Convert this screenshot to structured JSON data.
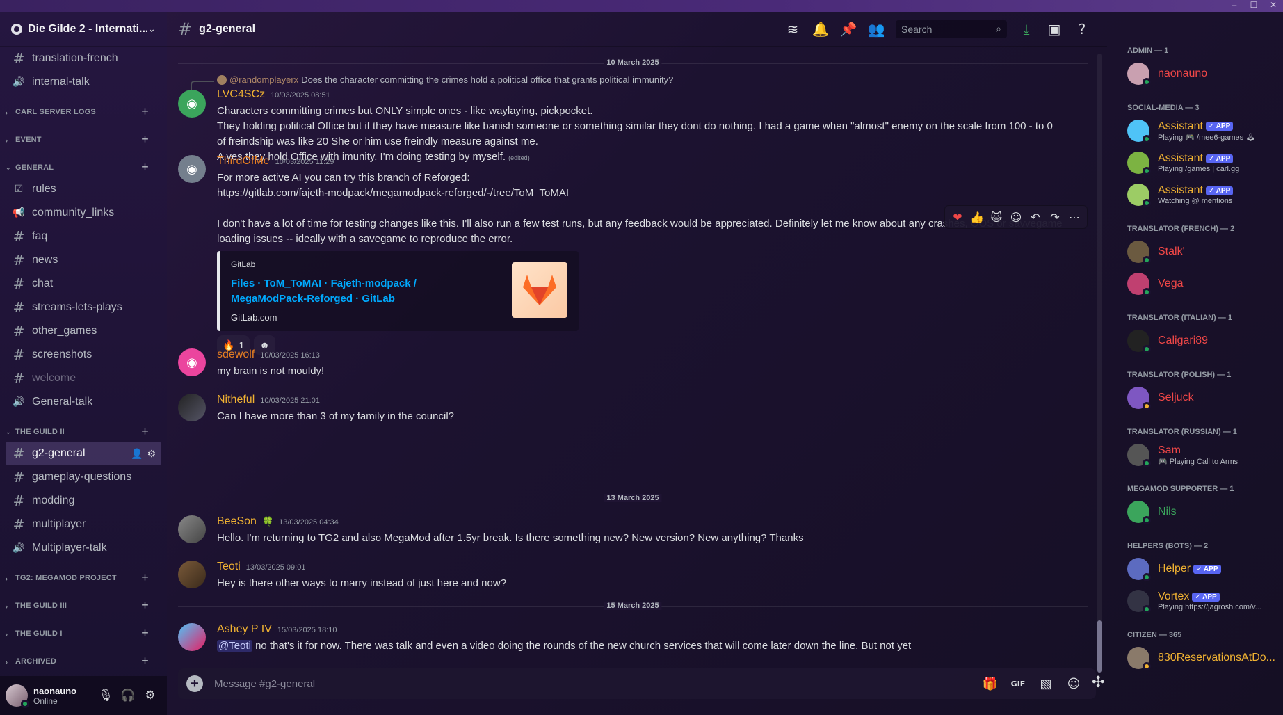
{
  "window": {
    "minimize": "–",
    "maximize": "☐",
    "close": "✕"
  },
  "server": {
    "name": "Die Gilde 2 - Internati..."
  },
  "sidebar": {
    "top_channels": [
      {
        "name": "translation-french",
        "icon": "hash-icon"
      },
      {
        "name": "internal-talk",
        "icon": "speaker-icon"
      }
    ],
    "categories": [
      {
        "label": "CARL SERVER LOGS",
        "collapsed": true,
        "channels": []
      },
      {
        "label": "EVENT",
        "collapsed": true,
        "channels": []
      },
      {
        "label": "GENERAL",
        "collapsed": false,
        "channels": [
          {
            "name": "rules",
            "icon": "checklist-icon"
          },
          {
            "name": "community_links",
            "icon": "megaphone-icon"
          },
          {
            "name": "faq",
            "icon": "hash-icon"
          },
          {
            "name": "news",
            "icon": "hash-icon"
          },
          {
            "name": "chat",
            "icon": "hash-icon"
          },
          {
            "name": "streams-lets-plays",
            "icon": "hash-icon"
          },
          {
            "name": "other_games",
            "icon": "hash-icon"
          },
          {
            "name": "screenshots",
            "icon": "hash-icon"
          },
          {
            "name": "welcome",
            "icon": "hash-icon",
            "muted": true
          },
          {
            "name": "General-talk",
            "icon": "speaker-icon"
          }
        ]
      },
      {
        "label": "THE GUILD II",
        "collapsed": false,
        "channels": [
          {
            "name": "g2-general",
            "icon": "hash-icon",
            "active": true
          },
          {
            "name": "gameplay-questions",
            "icon": "hash-icon"
          },
          {
            "name": "modding",
            "icon": "hash-icon"
          },
          {
            "name": "multiplayer",
            "icon": "hash-icon"
          },
          {
            "name": "Multiplayer-talk",
            "icon": "speaker-icon"
          }
        ]
      },
      {
        "label": "TG2: MEGAMOD PROJECT",
        "collapsed": true,
        "channels": []
      },
      {
        "label": "THE GUILD III",
        "collapsed": true,
        "channels": []
      },
      {
        "label": "THE GUILD I",
        "collapsed": true,
        "channels": []
      },
      {
        "label": "ARCHIVED",
        "collapsed": true,
        "channels": []
      }
    ]
  },
  "user": {
    "name": "naonauno",
    "status": "Online"
  },
  "channel": {
    "name": "g2-general",
    "search_placeholder": "Search",
    "composer_placeholder": "Message #g2-general"
  },
  "dividers": [
    "10 March 2025",
    "13 March 2025",
    "15 March 2025"
  ],
  "messages": [
    {
      "reply_to": "@randomplayerx",
      "reply_text": "Does the character committing the crimes hold a political office that grants political immunity?",
      "author": "LVC4SCz",
      "author_color": "#f0b232",
      "time": "10/03/2025 08:51",
      "lines": [
        "Characters committing crimes but ONLY simple ones - like  waylaying, pickpocket.",
        "They holding political Office but if they have measure like banish someone or something similar they dont do nothing. I had a game when \"almost\" enemy on the scale from 100 - to 0",
        "of freindship was like 20 She or him use freindly measure against me.",
        "A yes they hold Office with imunity. I'm doing testing by myself."
      ],
      "edited": "(edited)"
    },
    {
      "author": "ThirdOfMe",
      "author_color": "#e67e22",
      "time": "10/03/2025 11:29",
      "lines": [
        "For more active AI you can try this branch of Reforged:"
      ],
      "link": "https://gitlab.com/fajeth-modpack/megamodpack-reforged/-/tree/ToM_ToMAI",
      "lines2": [
        "I don't have a lot of time for testing changes like this. I'll also run a few test runs, but any feedback would be appreciated. Definitely let me know about any crashes, OOS or savvegame",
        "loading issues -- ideally with a savegame to reproduce the error."
      ],
      "embed": {
        "provider": "GitLab",
        "title": "Files · ToM_ToMAI · Fajeth-modpack / MegaModPack-Reforged · GitLab",
        "site": "GitLab.com"
      },
      "reactions": [
        {
          "emoji": "🔥",
          "count": "1"
        },
        {
          "emoji": "☻",
          "count": ""
        }
      ]
    },
    {
      "author": "sdewolf",
      "author_color": "#e67e22",
      "time": "10/03/2025 16:13",
      "lines": [
        "my brain is not mouldy!"
      ]
    },
    {
      "author": "Nitheful",
      "author_color": "#f0b232",
      "time": "10/03/2025 21:01",
      "lines": [
        "Can I have more than 3 of my family in the council?"
      ]
    },
    {
      "author": "BeeSon",
      "author_color": "#f0b232",
      "time": "13/03/2025 04:34",
      "badge": "🍀",
      "lines": [
        "Hello. I'm returning to TG2 and also MegaMod after 1.5yr break. Is there something new? New version? New anything? Thanks"
      ]
    },
    {
      "author": "Teoti",
      "author_color": "#f0b232",
      "time": "13/03/2025 09:01",
      "lines": [
        "Hey is there other ways to marry instead of just here and now?"
      ]
    },
    {
      "author": "Ashey P IV",
      "author_color": "#f0b232",
      "time": "15/03/2025 18:10",
      "mention": "@Teoti",
      "lines": [
        "no that's it for now. There was talk and even a video doing the rounds of the new church services that will come later down the line. But not yet"
      ]
    }
  ],
  "hover_actions": [
    "❤",
    "👍",
    "🐱",
    "☺",
    "↶",
    "↷",
    "⋯"
  ],
  "members": {
    "groups": [
      {
        "label": "ADMIN — 1",
        "items": [
          {
            "name": "naonauno",
            "color": "#f04747",
            "activity": ""
          }
        ]
      },
      {
        "label": "SOCIAL-MEDIA — 3",
        "items": [
          {
            "name": "Assistant",
            "color": "#f0b232",
            "app": "✓ APP",
            "activity": "Playing 🎮 /mee6-games 🕹"
          },
          {
            "name": "Assistant",
            "color": "#f0b232",
            "app": "✓ APP",
            "activity": "Playing /games | carl.gg"
          },
          {
            "name": "Assistant",
            "color": "#f0b232",
            "app": "✓ APP",
            "activity": "Watching @ mentions"
          }
        ]
      },
      {
        "label": "TRANSLATOR (FRENCH) — 2",
        "items": [
          {
            "name": "Stalk'",
            "color": "#f04747",
            "activity": ""
          },
          {
            "name": "Vega",
            "color": "#f04747",
            "activity": ""
          }
        ]
      },
      {
        "label": "TRANSLATOR (ITALIAN) — 1",
        "items": [
          {
            "name": "Caligari89",
            "color": "#f04747",
            "activity": ""
          }
        ]
      },
      {
        "label": "TRANSLATOR (POLISH) — 1",
        "items": [
          {
            "name": "Seljuck",
            "color": "#f04747",
            "activity": ""
          }
        ]
      },
      {
        "label": "TRANSLATOR (RUSSIAN) — 1",
        "items": [
          {
            "name": "Sam",
            "color": "#f04747",
            "activity": "🎮 Playing Call to Arms"
          }
        ]
      },
      {
        "label": "MEGAMOD SUPPORTER — 1",
        "items": [
          {
            "name": "Nils",
            "color": "#3ba55c",
            "activity": ""
          }
        ]
      },
      {
        "label": "HELPERS (BOTS) — 2",
        "items": [
          {
            "name": "Helper",
            "color": "#f0b232",
            "app": "✓ APP",
            "activity": ""
          },
          {
            "name": "Vortex",
            "color": "#f0b232",
            "app": "✓ APP",
            "activity": "Playing https://jagrosh.com/v..."
          }
        ]
      },
      {
        "label": "CITIZEN — 365",
        "items": [
          {
            "name": "830ReservationsAtDo...",
            "color": "#f0b232",
            "activity": ""
          }
        ]
      }
    ]
  },
  "colors": {
    "accent": "#5865f2",
    "link": "#00a8fc",
    "online": "#23a55a",
    "idle": "#f0b232"
  }
}
